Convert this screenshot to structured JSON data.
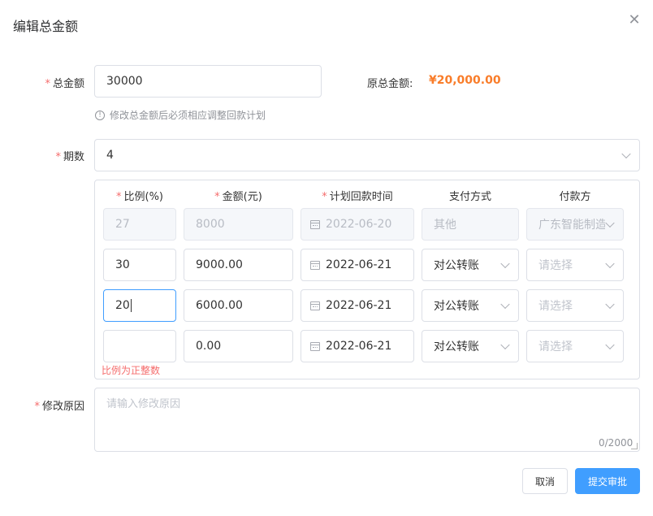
{
  "dialog": {
    "title": "编辑总金额",
    "close_icon": "close-icon"
  },
  "total": {
    "label": "总金额",
    "value": "30000",
    "original_label": "原总金额:",
    "original_value": "¥20,000.00",
    "tip": "修改总金额后必须相应调整回款计划"
  },
  "periods": {
    "label": "期数",
    "value": "4"
  },
  "table": {
    "headers": {
      "ratio": "比例(%)",
      "amount": "金额(元)",
      "date": "计划回款时间",
      "method": "支付方式",
      "payer": "付款方"
    },
    "rows": [
      {
        "ratio": "27",
        "amount": "8000",
        "date": "2022-06-20",
        "method": "其他",
        "payer": "广东智能制造",
        "disabled": true
      },
      {
        "ratio": "30",
        "amount": "9000.00",
        "date": "2022-06-21",
        "method": "对公转账",
        "payer": "请选择",
        "disabled": false
      },
      {
        "ratio": "20",
        "amount": "6000.00",
        "date": "2022-06-21",
        "method": "对公转账",
        "payer": "请选择",
        "disabled": false
      },
      {
        "ratio": "",
        "amount": "0.00",
        "date": "2022-06-21",
        "method": "对公转账",
        "payer": "请选择",
        "disabled": false
      }
    ],
    "error": "比例为正整数"
  },
  "reason": {
    "label": "修改原因",
    "placeholder": "请输入修改原因",
    "counter": "0/2000"
  },
  "footer": {
    "cancel": "取消",
    "submit": "提交审批"
  },
  "colors": {
    "accent": "#409eff",
    "price": "#f97d2a",
    "required": "#f56c6c"
  }
}
